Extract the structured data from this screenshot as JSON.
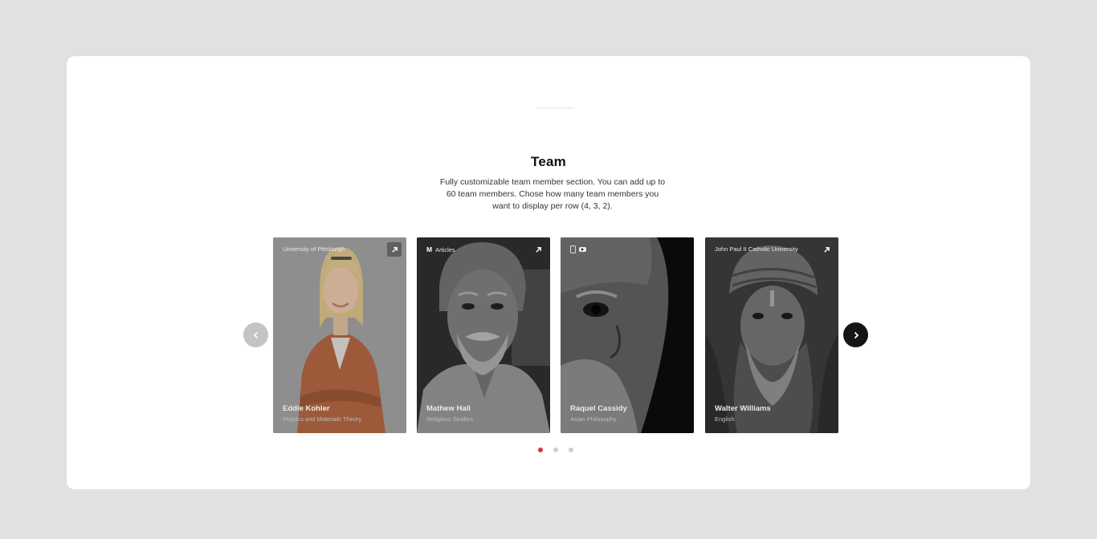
{
  "section": {
    "title": "Team",
    "description": "Fully customizable team member section. You can add up to 60 team members. Chose how many team members you want to display per row (4, 3, 2)."
  },
  "members": [
    {
      "top_label": "University of Pittsburgh",
      "name": "Eddie Kohler",
      "role": "Physics and Materials Theory"
    },
    {
      "top_label": "Articles",
      "name": "Mathew Hall",
      "role": "Religious Studies"
    },
    {
      "top_label": "",
      "name": "Raquel Cassidy",
      "role": "Asian Philosophy"
    },
    {
      "top_label": "John Paul II Catholic University",
      "name": "Walter Williams",
      "role": "English"
    }
  ],
  "carousel": {
    "pages": 3,
    "active_page": 1
  },
  "colors": {
    "accent": "#e0303a",
    "background": "#e1e1e1",
    "panel": "#ffffff"
  }
}
